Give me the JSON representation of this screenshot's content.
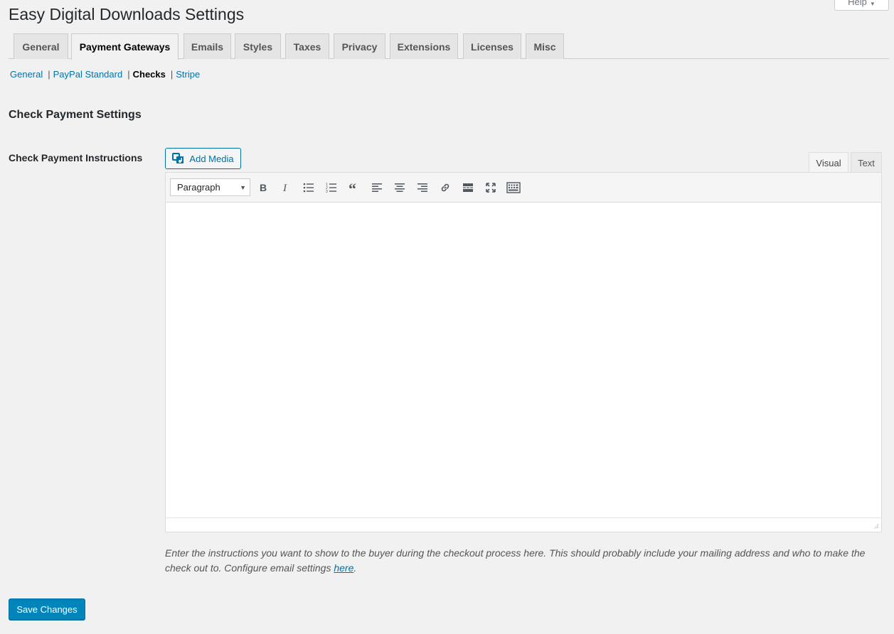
{
  "header": {
    "title": "Easy Digital Downloads Settings",
    "help_label": "Help"
  },
  "tabs": [
    {
      "label": "General",
      "active": false
    },
    {
      "label": "Payment Gateways",
      "active": true
    },
    {
      "label": "Emails",
      "active": false
    },
    {
      "label": "Styles",
      "active": false
    },
    {
      "label": "Taxes",
      "active": false
    },
    {
      "label": "Privacy",
      "active": false
    },
    {
      "label": "Extensions",
      "active": false
    },
    {
      "label": "Licenses",
      "active": false
    },
    {
      "label": "Misc",
      "active": false
    }
  ],
  "subnav": {
    "items": [
      {
        "label": "General",
        "current": false
      },
      {
        "label": "PayPal Standard",
        "current": false
      },
      {
        "label": "Checks",
        "current": true
      },
      {
        "label": "Stripe",
        "current": false
      }
    ],
    "separator": "|"
  },
  "section": {
    "title": "Check Payment Settings",
    "field_label": "Check Payment Instructions"
  },
  "editor": {
    "add_media_label": "Add Media",
    "mode_visual": "Visual",
    "mode_text": "Text",
    "format_value": "Paragraph",
    "toolbar_icons": [
      "bold-icon",
      "italic-icon",
      "bullet-list-icon",
      "numbered-list-icon",
      "blockquote-icon",
      "align-left-icon",
      "align-center-icon",
      "align-right-icon",
      "link-icon",
      "read-more-icon",
      "fullscreen-icon",
      "toolbar-toggle-icon"
    ],
    "content": ""
  },
  "description": {
    "text": "Enter the instructions you want to show to the buyer during the checkout process here. This should probably include your mailing address and who to make the check out to. Configure email settings ",
    "link_text": "here",
    "suffix": "."
  },
  "footer": {
    "save_label": "Save Changes"
  },
  "colors": {
    "accent": "#0073aa",
    "primary_button": "#0085ba",
    "background": "#f1f1f1"
  }
}
